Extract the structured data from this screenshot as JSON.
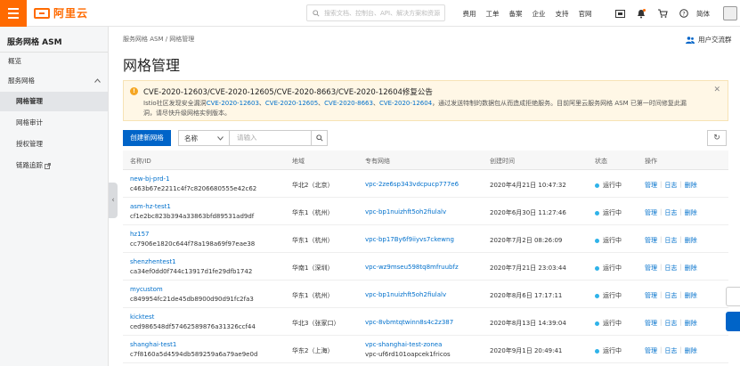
{
  "topbar": {
    "logo_text": "阿里云",
    "search_placeholder": "搜索文档、控制台、API、解决方案和资源",
    "links": [
      "费用",
      "工单",
      "备案",
      "企业",
      "支持",
      "官网"
    ],
    "language": "简体"
  },
  "sidebar": {
    "title": "服务网格 ASM",
    "items": [
      {
        "label": "概览"
      },
      {
        "label": "服务网格"
      },
      {
        "label": "网格管理"
      },
      {
        "label": "网格审计"
      },
      {
        "label": "授权管理"
      },
      {
        "label": "链路追踪"
      }
    ]
  },
  "header": {
    "breadcrumb": "服务网格 ASM   /   网格管理",
    "page_title": "网格管理",
    "group_link": "用户交流群"
  },
  "notice": {
    "title": "CVE-2020-12603/CVE-2020-12605/CVE-2020-8663/CVE-2020-12604修复公告",
    "body_prefix": "Istio社区发现安全漏洞",
    "cves": [
      "CVE-2020-12603",
      "CVE-2020-12605",
      "CVE-2020-8663",
      "CVE-2020-12604"
    ],
    "body_suffix": "，通过发送特制的数据包从而造成拒绝服务。目前阿里云服务网格 ASM 已第一时间修复此漏洞，请尽快升级网格实例版本。"
  },
  "toolbar": {
    "create_label": "创建新网格",
    "filter_select": "名称",
    "filter_placeholder": "请输入"
  },
  "table": {
    "headers": [
      "名称/ID",
      "地域",
      "专有网络",
      "创建时间",
      "状态",
      "操作"
    ],
    "op_labels": [
      "管理",
      "日志",
      "删除"
    ],
    "rows": [
      {
        "name": "new-bj-prd-1",
        "id": "c463b67e2211c4f7c8206680555e42c62",
        "region": "华北2（北京）",
        "vpc": "vpc-2ze6sp343vdcpucp777e6",
        "vpc_id": "",
        "created": "2020年4月21日 10:47:32",
        "status": "运行中"
      },
      {
        "name": "asm-hz-test1",
        "id": "cf1e2bc823b394a33863bfd89531ad9df",
        "region": "华东1（杭州）",
        "vpc": "vpc-bp1nuizhft5oh2fiulalv",
        "vpc_id": "",
        "created": "2020年6月30日 11:27:46",
        "status": "运行中"
      },
      {
        "name": "hz157",
        "id": "cc7906e1820c644f78a198a69f97eae38",
        "region": "华东1（杭州）",
        "vpc": "vpc-bp17By6f9iiyvs7ckewng",
        "vpc_id": "",
        "created": "2020年7月2日 08:26:09",
        "status": "运行中"
      },
      {
        "name": "shenzhentest1",
        "id": "ca34ef0dd0f744c13917d1fe29dfb1742",
        "region": "华南1（深圳）",
        "vpc": "vpc-wz9mseu598tq8mfruubfz",
        "vpc_id": "",
        "created": "2020年7月21日 23:03:44",
        "status": "运行中"
      },
      {
        "name": "mycustom",
        "id": "c849954fc21de45db8900d90d91fc2fa3",
        "region": "华东1（杭州）",
        "vpc": "vpc-bp1nuizhft5oh2fiulalv",
        "vpc_id": "",
        "created": "2020年8月6日 17:17:11",
        "status": "运行中"
      },
      {
        "name": "kicktest",
        "id": "ced986548df57462589876a31326ccf44",
        "region": "华北3（张家口）",
        "vpc": "vpc-8vbmtqtwinn8s4c2z387",
        "vpc_id": "",
        "created": "2020年8月13日 14:39:04",
        "status": "运行中"
      },
      {
        "name": "shanghai-test1",
        "id": "c7f8160a5d4594db589259a6a79ae9e0d",
        "region": "华东2（上海）",
        "vpc": "vpc-shanghai-test-zonea",
        "vpc_id": "vpc-uf6rd101oapcek1fricos",
        "created": "2020年9月1日 20:49:41",
        "status": "运行中"
      }
    ]
  }
}
